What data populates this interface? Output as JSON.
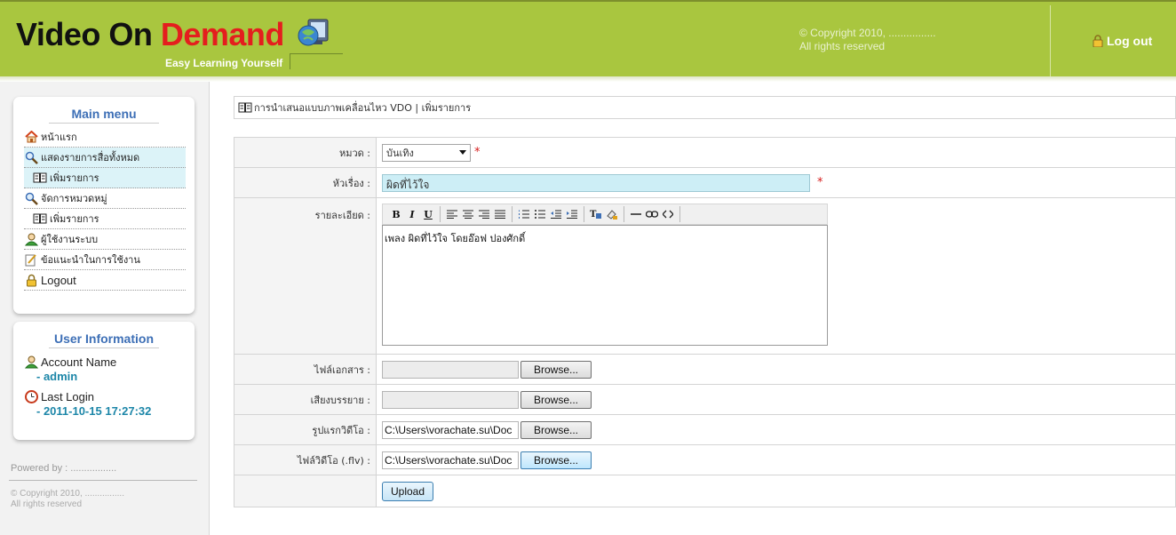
{
  "header": {
    "logo_part1": "Video On ",
    "logo_part2": "Demand",
    "tagline": "Easy Learning Yourself",
    "copyright_line1": "© Copyright 2010, ................",
    "copyright_line2": "All rights reserved",
    "logout_label": "Log out"
  },
  "sidebar": {
    "main_menu_title": "Main menu",
    "menu_items": [
      {
        "label": "หน้าแรก",
        "icon": "home-icon"
      },
      {
        "label": "แสดงรายการสื่อทั้งหมด",
        "icon": "magnifier-icon"
      },
      {
        "label": "เพิ่มรายการ",
        "icon": "book-icon"
      },
      {
        "label": "จัดการหมวดหมู่",
        "icon": "magnifier-icon"
      },
      {
        "label": "เพิ่มรายการ",
        "icon": "book-icon"
      },
      {
        "label": "ผู้ใช้งานระบบ",
        "icon": "user-icon"
      },
      {
        "label": "ข้อแนะนำในการใช้งาน",
        "icon": "edit-icon"
      },
      {
        "label": "Logout",
        "icon": "lock-icon"
      }
    ],
    "user_info_title": "User Information",
    "account_label": "Account Name",
    "account_value": "- admin",
    "last_login_label": "Last Login",
    "last_login_value": "- 2011-10-15 17:27:32",
    "powered_by": "Powered by : .................",
    "copyright_line1": "© Copyright 2010, ................",
    "copyright_line2": "All rights reserved"
  },
  "breadcrumb": "การนำเสนอแบบภาพเคลื่อนไหว VDO | เพิ่มรายการ",
  "form": {
    "category_label": "หมวด :",
    "category_value": "บันเทิง",
    "title_label": "หัวเรื่อง :",
    "title_value": "ผิดที่ไว้ใจ",
    "detail_label": "รายละเอียด :",
    "detail_value": "เพลง ผิดที่ไว้ใจ โดยอ๊อฟ ปองศักดิ์",
    "doc_file_label": "ไฟล์เอกสาร :",
    "doc_file_value": "",
    "audio_file_label": "เสียงบรรยาย :",
    "audio_file_value": "",
    "thumb_label": "รูปแรกวิดีโอ :",
    "thumb_value": "C:\\Users\\vorachate.su\\Doc",
    "video_label": "ไฟล์วิดีโอ (.flv) :",
    "video_value": "C:\\Users\\vorachate.su\\Doc",
    "browse_label": "Browse...",
    "upload_label": "Upload",
    "required_mark": "*"
  },
  "colors": {
    "header_bg": "#a9c63f",
    "accent_red": "#e41e1e",
    "menu_title": "#3d6fb6",
    "user_value": "#1c86a8"
  }
}
